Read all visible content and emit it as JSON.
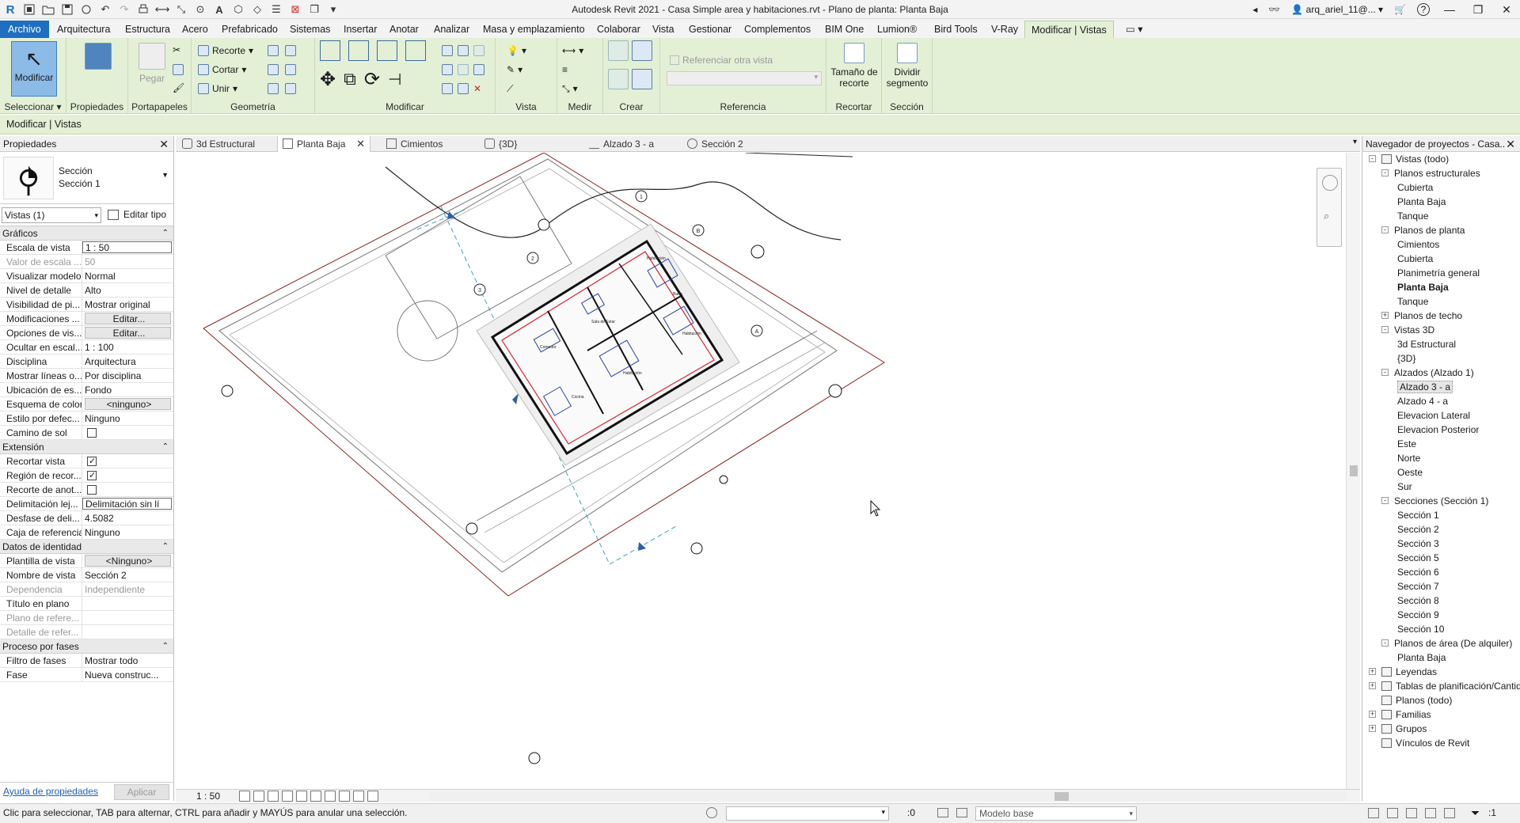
{
  "titlebar": {
    "title": "Autodesk Revit 2021 - Casa Simple area y habitaciones.rvt - Plano de planta: Planta Baja",
    "user": "arq_ariel_11@...",
    "help": "?"
  },
  "ribbon_tabs": [
    "Archivo",
    "Arquitectura",
    "Estructura",
    "Acero",
    "Prefabricado",
    "Sistemas",
    "Insertar",
    "Anotar",
    "Analizar",
    "Masa y emplazamiento",
    "Colaborar",
    "Vista",
    "Gestionar",
    "Complementos",
    "BIM One",
    "Lumion®",
    "Bird Tools",
    "V-Ray",
    "Modificar | Vistas"
  ],
  "ribbon": {
    "modify_label": "Modificar",
    "properties_label": "Propiedades",
    "paste_label": "Pegar",
    "cope_label": "Recorte",
    "cut_label": "Cortar",
    "join_label": "Unir",
    "ref_other_view": "Referenciar otra vista",
    "crop_size_label": "Tamaño de\nrecorte",
    "split_segment_label": "Dividir\nsegmento",
    "panels": {
      "select": "Seleccionar",
      "properties": "Propiedades",
      "clipboard": "Portapapeles",
      "geometry": "Geometría",
      "modify": "Modificar",
      "view": "Vista",
      "measure": "Medir",
      "create": "Crear",
      "reference": "Referencia",
      "crop": "Recortar",
      "section": "Sección"
    }
  },
  "optionsbar": {
    "context": "Modificar | Vistas"
  },
  "properties": {
    "title": "Propiedades",
    "type_family": "Sección",
    "type_name": "Sección 1",
    "instance_filter": "Vistas (1)",
    "edit_type": "Editar tipo",
    "groups": [
      {
        "name": "Gráficos",
        "rows": [
          {
            "name": "Escala de vista",
            "value": "1 : 50",
            "style": "boxed"
          },
          {
            "name": "Valor de escala ...",
            "value": "50",
            "style": "gray"
          },
          {
            "name": "Visualizar modelo",
            "value": "Normal"
          },
          {
            "name": "Nivel de detalle",
            "value": "Alto"
          },
          {
            "name": "Visibilidad de pi...",
            "value": "Mostrar original"
          },
          {
            "name": "Modificaciones ...",
            "value": "Editar...",
            "style": "btn"
          },
          {
            "name": "Opciones de vis...",
            "value": "Editar...",
            "style": "btn"
          },
          {
            "name": "Ocultar en escal...",
            "value": "1 : 100"
          },
          {
            "name": "Disciplina",
            "value": "Arquitectura"
          },
          {
            "name": "Mostrar líneas o...",
            "value": "Por disciplina"
          },
          {
            "name": "Ubicación de es...",
            "value": "Fondo"
          },
          {
            "name": "Esquema de color",
            "value": "<ninguno>",
            "style": "btn"
          },
          {
            "name": "Estilo por defec...",
            "value": "Ninguno"
          },
          {
            "name": "Camino de sol",
            "value": "",
            "style": "check-off"
          }
        ]
      },
      {
        "name": "Extensión",
        "rows": [
          {
            "name": "Recortar vista",
            "value": "",
            "style": "check-on"
          },
          {
            "name": "Región de recor...",
            "value": "",
            "style": "check-on"
          },
          {
            "name": "Recorte de anot...",
            "value": "",
            "style": "check-off"
          },
          {
            "name": "Delimitación lej...",
            "value": "Delimitación sin lí",
            "style": "boxed"
          },
          {
            "name": "Desfase de deli...",
            "value": "4.5082"
          },
          {
            "name": "Caja de referencia",
            "value": "Ninguno"
          }
        ]
      },
      {
        "name": "Datos de identidad",
        "rows": [
          {
            "name": "Plantilla de vista",
            "value": "<Ninguno>",
            "style": "btn"
          },
          {
            "name": "Nombre de vista",
            "value": "Sección 2"
          },
          {
            "name": "Dependencia",
            "value": "Independiente",
            "style": "gray"
          },
          {
            "name": "Título en plano",
            "value": ""
          },
          {
            "name": "Plano de refere...",
            "value": "",
            "style": "gray"
          },
          {
            "name": "Detalle de refer...",
            "value": "",
            "style": "gray"
          }
        ]
      },
      {
        "name": "Proceso por fases",
        "rows": [
          {
            "name": "Filtro de fases",
            "value": "Mostrar todo"
          },
          {
            "name": "Fase",
            "value": "Nueva construc..."
          }
        ]
      }
    ],
    "help_link": "Ayuda de propiedades",
    "apply": "Aplicar"
  },
  "view_tabs": [
    {
      "label": "3d Estructural",
      "icon": "3d-view-icon"
    },
    {
      "label": "Planta Baja",
      "icon": "floor-plan-icon",
      "active": true
    },
    {
      "label": "Cimientos",
      "icon": "floor-plan-icon"
    },
    {
      "label": "{3D}",
      "icon": "3d-view-icon"
    },
    {
      "label": "Alzado 3 - a",
      "icon": "elevation-icon"
    },
    {
      "label": "Sección 2",
      "icon": "section-icon"
    }
  ],
  "view_control": {
    "scale": "1 : 50"
  },
  "browser": {
    "title": "Navegador de proyectos - Casa...",
    "tree": [
      {
        "label": "Vistas (todo)",
        "level": 0,
        "toggle": "-",
        "icon": true
      },
      {
        "label": "Planos estructurales",
        "level": 1,
        "toggle": "-"
      },
      {
        "label": "Cubierta",
        "level": 2
      },
      {
        "label": "Planta Baja",
        "level": 2
      },
      {
        "label": "Tanque",
        "level": 2
      },
      {
        "label": "Planos de planta",
        "level": 1,
        "toggle": "-"
      },
      {
        "label": "Cimientos",
        "level": 2
      },
      {
        "label": "Cubierta",
        "level": 2
      },
      {
        "label": "Planimetría general",
        "level": 2
      },
      {
        "label": "Planta Baja",
        "level": 2,
        "bold": true
      },
      {
        "label": "Tanque",
        "level": 2
      },
      {
        "label": "Planos de techo",
        "level": 1,
        "toggle": "+"
      },
      {
        "label": "Vistas 3D",
        "level": 1,
        "toggle": "-"
      },
      {
        "label": "3d Estructural",
        "level": 2
      },
      {
        "label": "{3D}",
        "level": 2
      },
      {
        "label": "Alzados (Alzado 1)",
        "level": 1,
        "toggle": "-"
      },
      {
        "label": "Alzado 3 - a",
        "level": 2,
        "highlight": true
      },
      {
        "label": "Alzado 4 - a",
        "level": 2
      },
      {
        "label": "Elevacion Lateral",
        "level": 2
      },
      {
        "label": "Elevacion Posterior",
        "level": 2
      },
      {
        "label": "Este",
        "level": 2
      },
      {
        "label": "Norte",
        "level": 2
      },
      {
        "label": "Oeste",
        "level": 2
      },
      {
        "label": "Sur",
        "level": 2
      },
      {
        "label": "Secciones (Sección 1)",
        "level": 1,
        "toggle": "-"
      },
      {
        "label": "Sección 1",
        "level": 2
      },
      {
        "label": "Sección 2",
        "level": 2
      },
      {
        "label": "Sección 3",
        "level": 2
      },
      {
        "label": "Sección 5",
        "level": 2
      },
      {
        "label": "Sección 6",
        "level": 2
      },
      {
        "label": "Sección 7",
        "level": 2
      },
      {
        "label": "Sección 8",
        "level": 2
      },
      {
        "label": "Sección 9",
        "level": 2
      },
      {
        "label": "Sección 10",
        "level": 2
      },
      {
        "label": "Planos de área (De alquiler)",
        "level": 1,
        "toggle": "-"
      },
      {
        "label": "Planta Baja",
        "level": 2
      },
      {
        "label": "Leyendas",
        "level": 0,
        "toggle": "+",
        "icon": true
      },
      {
        "label": "Tablas de planificación/Cantid",
        "level": 0,
        "toggle": "+",
        "icon": true
      },
      {
        "label": "Planos (todo)",
        "level": 0,
        "icon": true
      },
      {
        "label": "Familias",
        "level": 0,
        "toggle": "+",
        "icon": true
      },
      {
        "label": "Grupos",
        "level": 0,
        "toggle": "+",
        "icon": true
      },
      {
        "label": "Vínculos de Revit",
        "level": 0,
        "icon": true
      }
    ]
  },
  "status": {
    "text": "Clic para seleccionar, TAB para alternar, CTRL para añadir y MAYÚS para anular una selección.",
    "count": ":0",
    "model": "Modelo base",
    "filter": ":1"
  },
  "drawing": {
    "room_labels": [
      "Habitación",
      "Sala de Estar",
      "Comedor",
      "Cocina",
      "Habitación",
      "Habitación",
      "Baño"
    ],
    "grid_labels": [
      "1",
      "2",
      "3",
      "B",
      "A"
    ]
  }
}
